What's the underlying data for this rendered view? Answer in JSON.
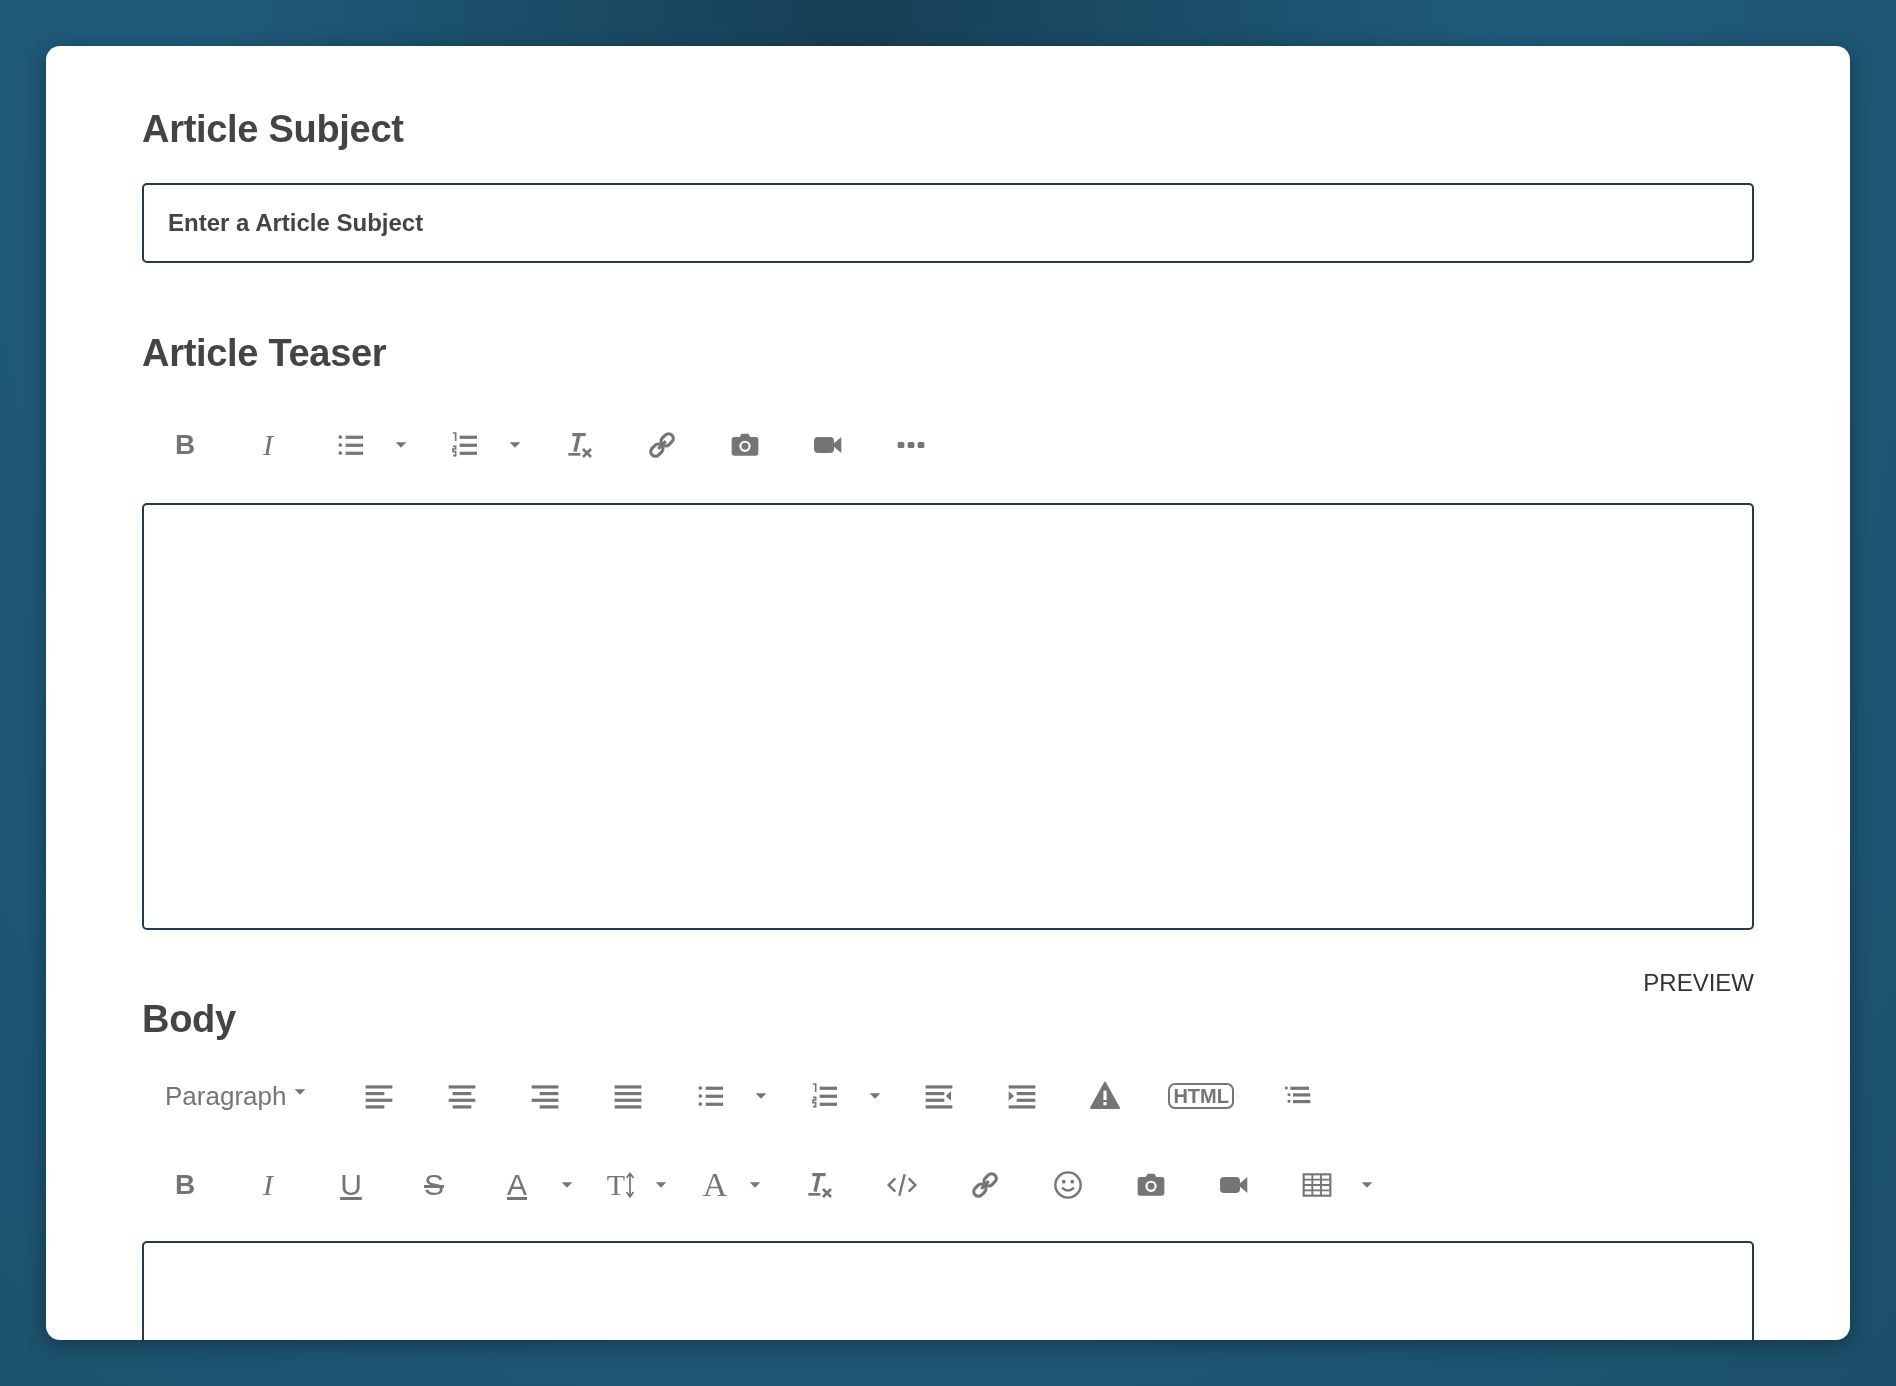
{
  "subject": {
    "heading": "Article Subject",
    "placeholder": "Enter a Article Subject"
  },
  "teaser": {
    "heading": "Article Teaser",
    "toolbar": [
      {
        "kind": "bold",
        "label": "B"
      },
      {
        "kind": "italic",
        "label": "I"
      },
      {
        "kind": "bullet-list"
      },
      {
        "kind": "caret"
      },
      {
        "kind": "numbered-list"
      },
      {
        "kind": "caret"
      },
      {
        "kind": "clear-format"
      },
      {
        "kind": "link"
      },
      {
        "kind": "camera"
      },
      {
        "kind": "video"
      },
      {
        "kind": "more"
      }
    ]
  },
  "preview": "PREVIEW",
  "body": {
    "heading": "Body",
    "toolbar_rows": [
      [
        {
          "kind": "dropdown",
          "label": "Paragraph"
        },
        {
          "kind": "align-left"
        },
        {
          "kind": "align-center"
        },
        {
          "kind": "align-right"
        },
        {
          "kind": "justify"
        },
        {
          "kind": "bullet-list"
        },
        {
          "kind": "caret"
        },
        {
          "kind": "numbered-list"
        },
        {
          "kind": "caret"
        },
        {
          "kind": "outdent"
        },
        {
          "kind": "indent"
        },
        {
          "kind": "warning"
        },
        {
          "kind": "html",
          "label": "HTML"
        },
        {
          "kind": "outline-list"
        }
      ],
      [
        {
          "kind": "bold",
          "label": "B"
        },
        {
          "kind": "italic",
          "label": "I"
        },
        {
          "kind": "underline",
          "label": "U"
        },
        {
          "kind": "strike",
          "label": "S"
        },
        {
          "kind": "font-color",
          "label": "A"
        },
        {
          "kind": "caret"
        },
        {
          "kind": "text-size",
          "label": "T"
        },
        {
          "kind": "caret"
        },
        {
          "kind": "font",
          "label": "A"
        },
        {
          "kind": "caret"
        },
        {
          "kind": "clear-format"
        },
        {
          "kind": "code"
        },
        {
          "kind": "link"
        },
        {
          "kind": "smiley"
        },
        {
          "kind": "camera"
        },
        {
          "kind": "video"
        },
        {
          "kind": "table"
        },
        {
          "kind": "caret"
        }
      ]
    ]
  }
}
